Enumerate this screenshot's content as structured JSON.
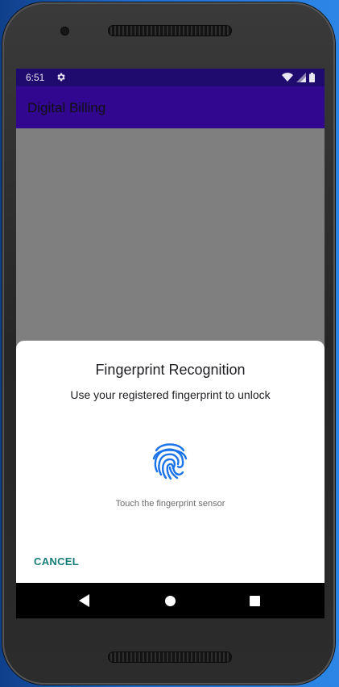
{
  "status_bar": {
    "time": "6:51",
    "icons": [
      "settings-icon",
      "wifi-icon",
      "signal-icon",
      "battery-icon"
    ]
  },
  "app_bar": {
    "title": "Digital Billing",
    "color": "#310790"
  },
  "biometric_dialog": {
    "title": "Fingerprint Recognition",
    "subtitle": "Use your registered fingerprint to unlock",
    "icon": "fingerprint-icon",
    "hint": "Touch the fingerprint sensor",
    "cancel_label": "CANCEL",
    "accent_color": "#167d78",
    "icon_color": "#1a73e8"
  },
  "navigation_bar": {
    "buttons": [
      "back-icon",
      "home-icon",
      "recents-icon"
    ]
  }
}
